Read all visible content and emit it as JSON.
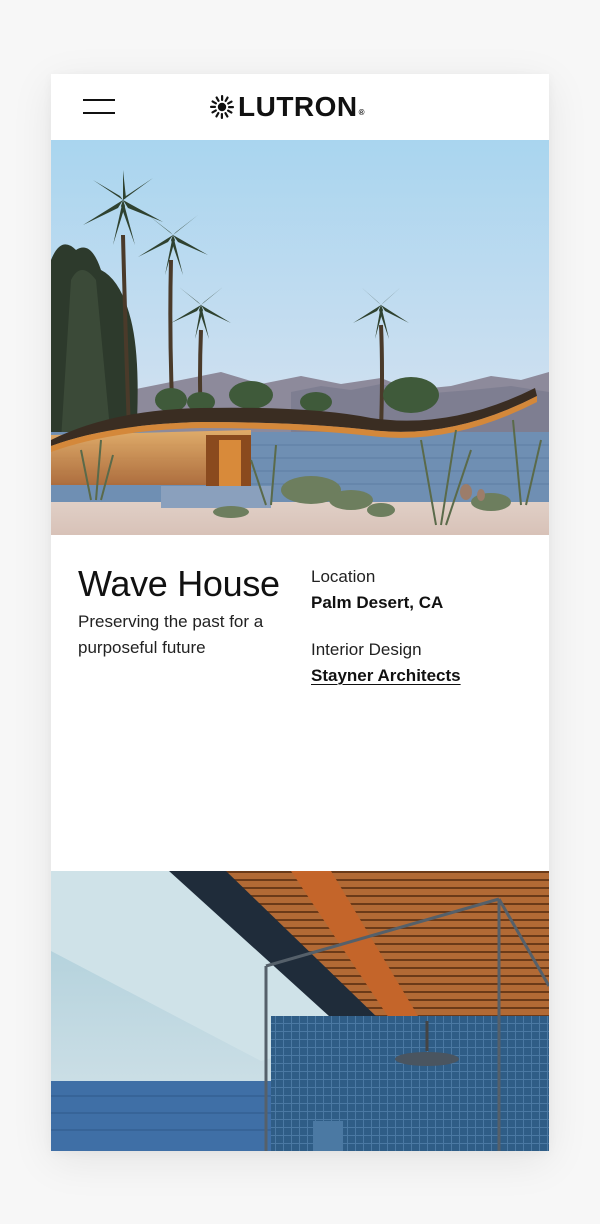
{
  "header": {
    "logo_text": "LUTRON",
    "logo_reg": "®"
  },
  "project": {
    "title": "Wave House",
    "subtitle": "Preserving the past for a purposeful future",
    "location_label": "Location",
    "location_value": "Palm Desert, CA",
    "design_label": "Interior Design",
    "design_value": "Stayner Architects"
  },
  "colors": {
    "text": "#111111",
    "sky_top": "#a8d4ee",
    "wall_blue": "#6b8db3",
    "roof_wood": "#b5682e"
  },
  "icons": [
    "menu-icon",
    "lutron-sun-logo-icon"
  ]
}
